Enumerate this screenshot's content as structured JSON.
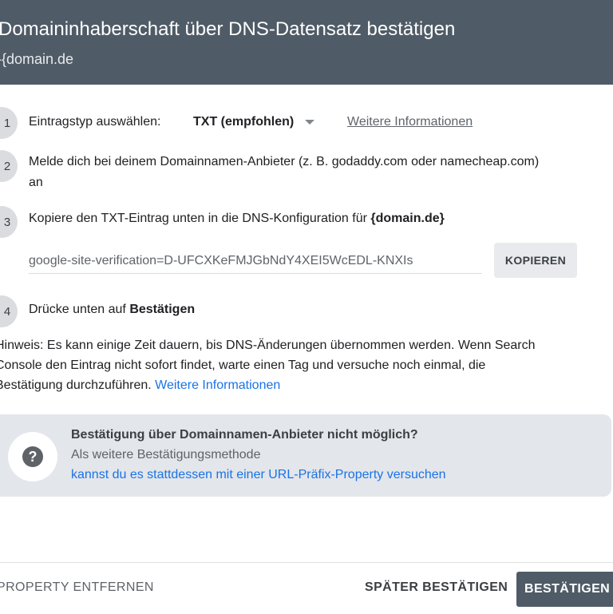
{
  "header": {
    "title": "Domaininhaberschaft über DNS-Datensatz bestätigen",
    "subtitle": "-{domain.de"
  },
  "steps": [
    {
      "number": "1",
      "label": "Eintragstyp auswählen:",
      "dropdown_value": "TXT (empfohlen)",
      "link": "Weitere Informationen"
    },
    {
      "number": "2",
      "text_line1": "Melde dich bei deinem Domainnamen-Anbieter (z. B. godaddy.com oder namecheap.com)",
      "text_line2": "an"
    },
    {
      "number": "3",
      "text": "Kopiere den TXT-Eintrag unten in die DNS-Konfiguration für",
      "domain": "{domain.de}",
      "record_value": "google-site-verification=D-UFCXKeFMJGbNdY4XEI5WcEDL-KNXIs",
      "copy_label": "KOPIEREN"
    },
    {
      "number": "4",
      "text": "Drücke unten auf",
      "bold": "Bestätigen"
    }
  ],
  "hint": {
    "line1": "Hinweis: Es kann einige Zeit dauern, bis DNS-Änderungen übernommen werden. Wenn Search",
    "line2": "Console den Eintrag nicht sofort findet, warte einen Tag und versuche noch einmal, die",
    "line3": "Bestätigung durchzuführen.",
    "link": "Weitere Informationen"
  },
  "info_box": {
    "icon": "help-icon",
    "title": "Bestätigung über Domainnamen-Anbieter nicht möglich?",
    "subtitle": "Als weitere Bestätigungsmethode",
    "link": "kannst du es stattdessen mit einer URL-Präfix-Property versuchen"
  },
  "footer": {
    "remove_label": "PROPERTY ENTFERNEN",
    "later_label": "SPÄTER BESTÄTIGEN",
    "confirm_label": "BESTÄTIGEN"
  },
  "colors": {
    "header_bg": "#4f5b66",
    "link_blue": "#1a73e8",
    "info_box_bg": "#e3e6ea"
  }
}
